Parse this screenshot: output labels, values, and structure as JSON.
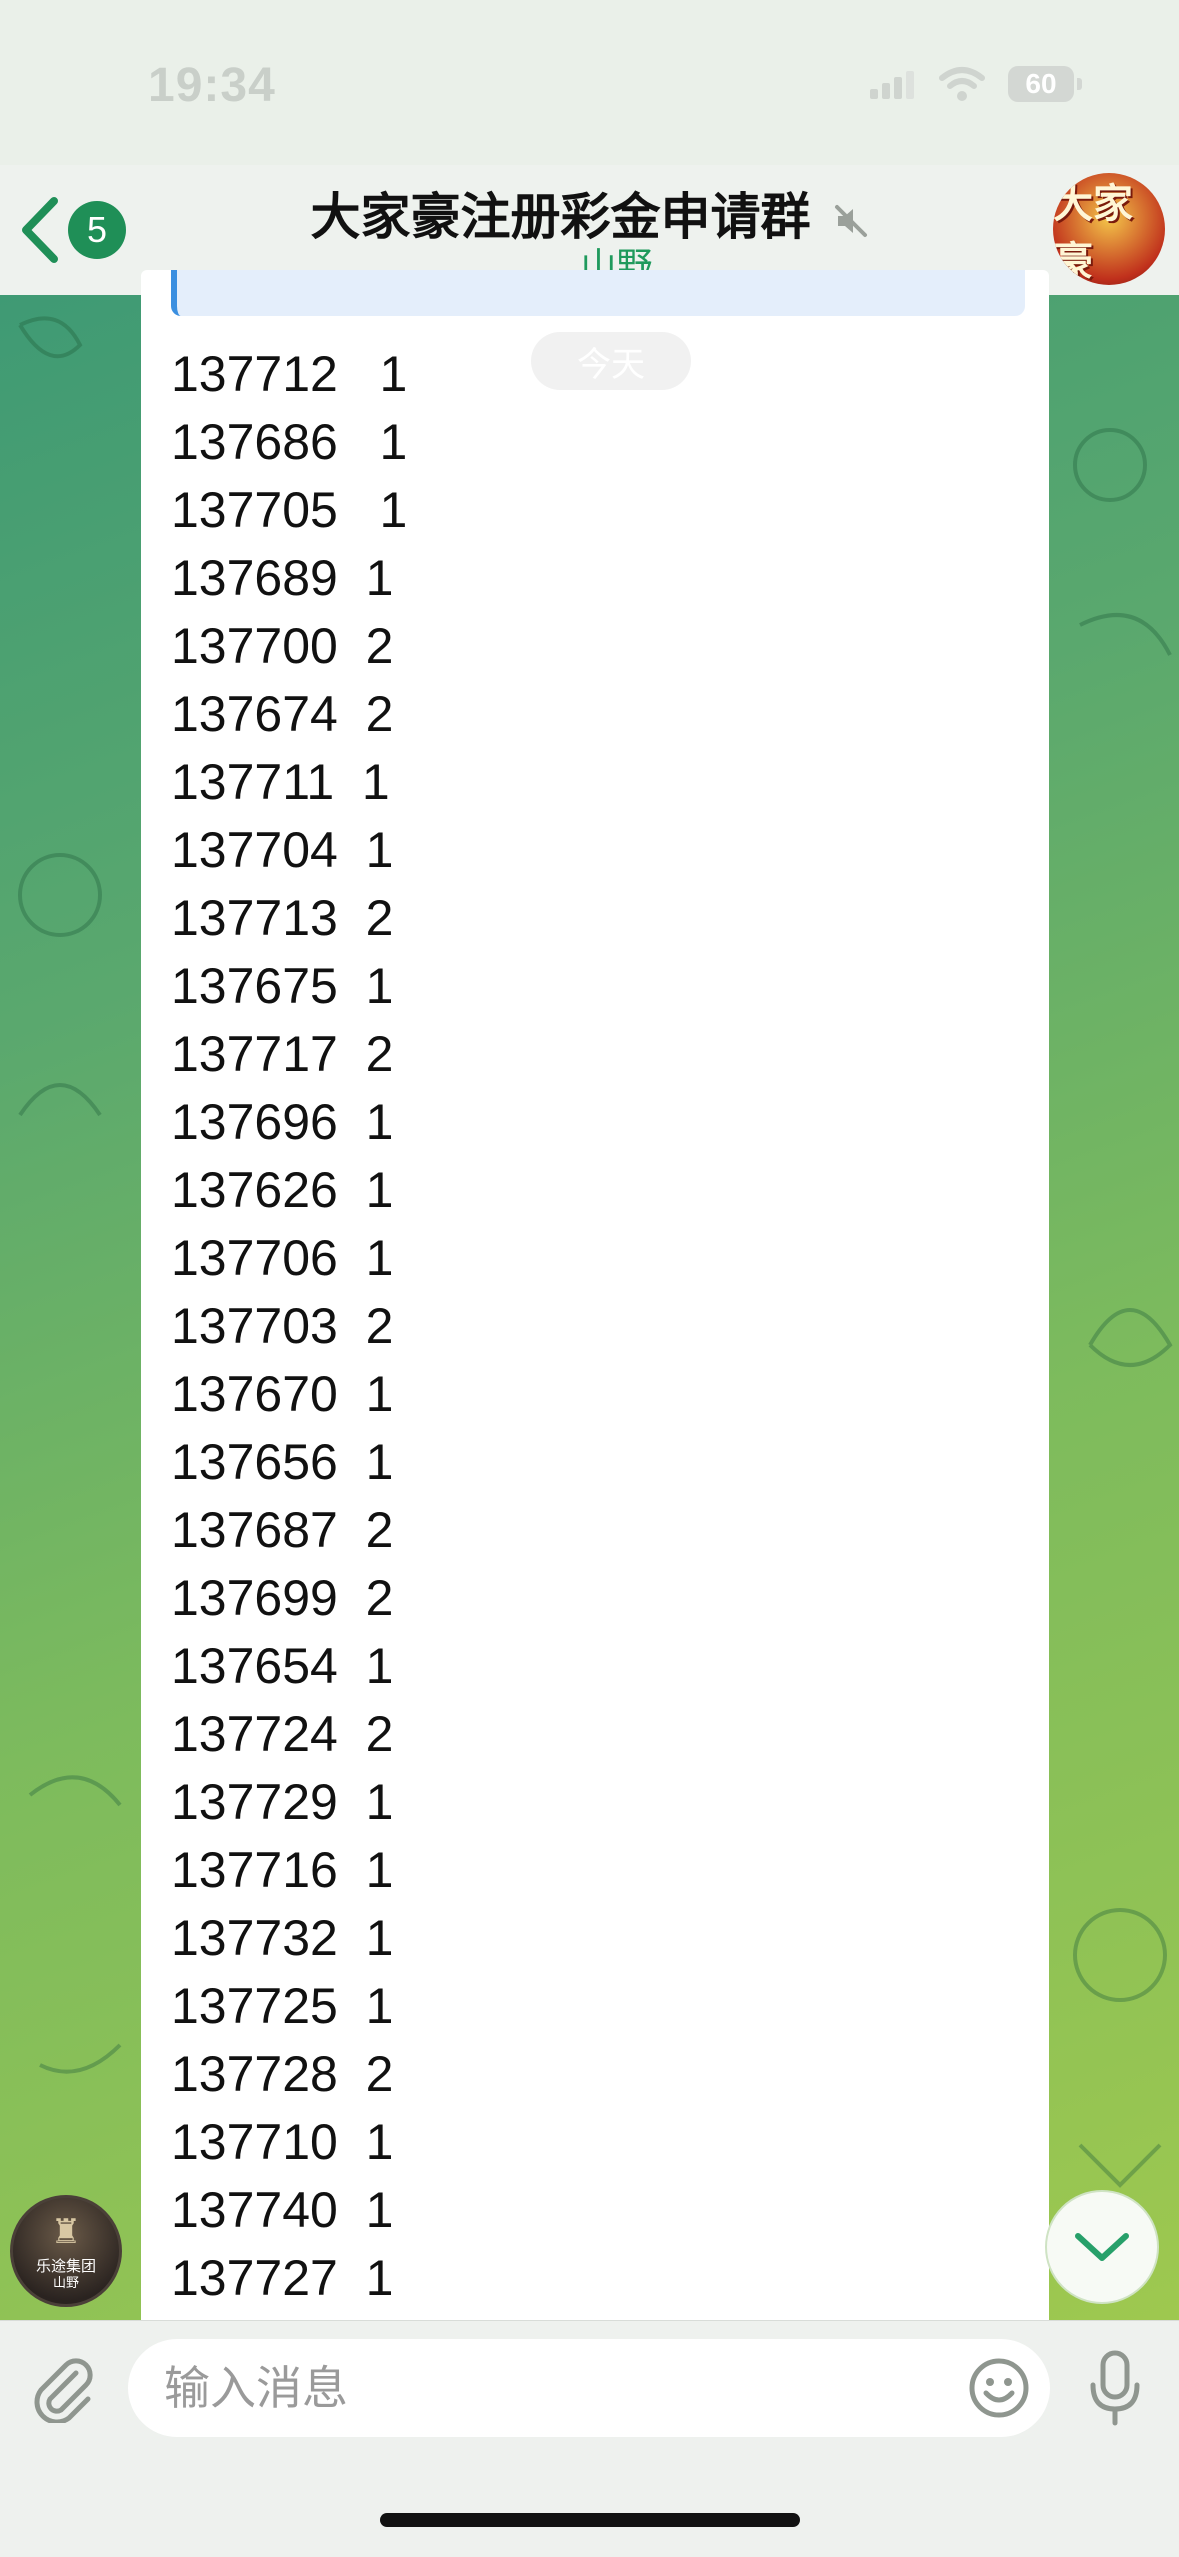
{
  "status_bar": {
    "time": "19:34",
    "battery": "60"
  },
  "header": {
    "back_badge": "5",
    "title": "大家豪注册彩金申请群",
    "subtitle": "山野",
    "avatar_text": "大家豪"
  },
  "message": {
    "date_label": "今天",
    "rows": [
      "137712   1",
      "137686   1",
      "137705   1",
      "137689  1",
      "137700  2",
      "137674  2",
      "137711  1",
      "137704  1",
      "137713  2",
      "137675  1",
      "137717  2",
      "137696  1",
      "137626  1",
      "137706  1",
      "137703  2",
      "137670  1",
      "137656  1",
      "137687  2",
      "137699  2",
      "137654  1",
      "137724  2",
      "137729  1",
      "137716  1",
      "137732  1",
      "137725  1",
      "137728  2",
      "137710  1",
      "137740  1",
      "137727  1"
    ]
  },
  "sender": {
    "group_name": "乐途集团",
    "name": "山野"
  },
  "input": {
    "placeholder": "输入消息"
  },
  "colors": {
    "accent": "#1f9a5c",
    "badge": "#1f8f57",
    "background_start": "#3f9a74",
    "background_end": "#9ec84f"
  },
  "icons": [
    "back-chevron-icon",
    "mute-icon",
    "attach-icon",
    "emoji-icon",
    "mic-icon",
    "chevron-down-icon"
  ]
}
